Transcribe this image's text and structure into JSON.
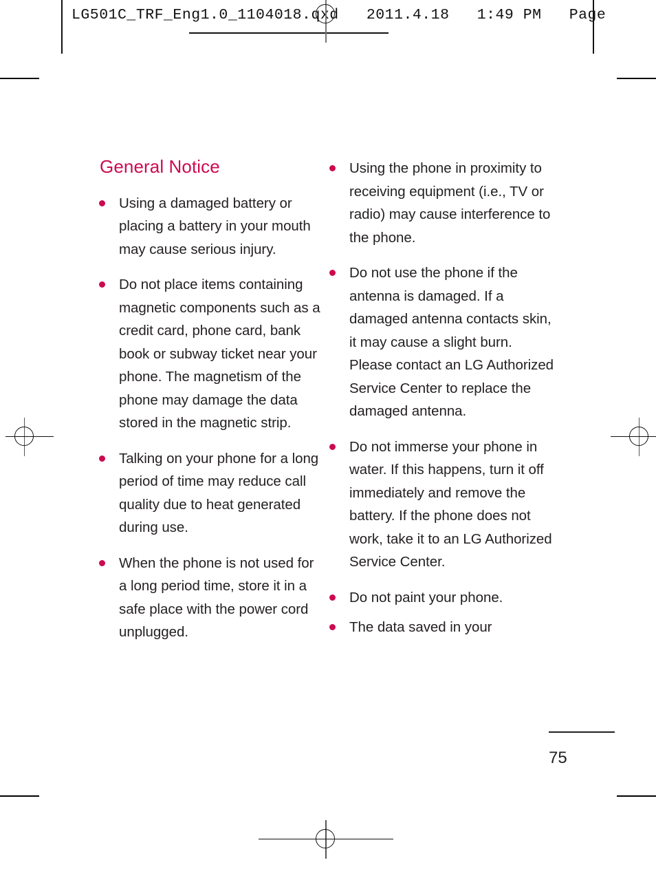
{
  "slug": {
    "text": "LG501C_TRF_Eng1.0_1104018.qxd   2011.4.18   1:49 PM   Page"
  },
  "section": {
    "title": "General Notice"
  },
  "left_column": {
    "bullets": [
      "Using a damaged battery or placing a battery in your mouth may cause serious injury.",
      "Do not place items containing magnetic components such as a credit card, phone card, bank book or subway ticket near your phone. The magnetism of the phone may damage the data stored in the magnetic strip.",
      "Talking on your phone for a long period of time may reduce call quality due to heat generated during use.",
      "When the phone is not used for a long period time, store it in a safe place with the power cord unplugged."
    ]
  },
  "right_column": {
    "bullets": [
      "Using the phone in proximity to receiving equipment (i.e., TV or radio) may cause interference to the phone.",
      "Do not use the phone if the antenna is damaged. If a damaged antenna contacts skin, it may cause a slight burn. Please contact an LG Authorized Service Center to replace the damaged antenna.",
      "Do not immerse your phone in water. If this happens, turn it off immediately and remove the battery. If the phone does not work, take it to an LG Authorized Service Center.",
      "Do not paint your phone.",
      "The data saved in your"
    ]
  },
  "folio": {
    "page_number": "75"
  },
  "colors": {
    "accent": "#cc0a50",
    "body_text": "#231f20",
    "marks": "#111111"
  }
}
